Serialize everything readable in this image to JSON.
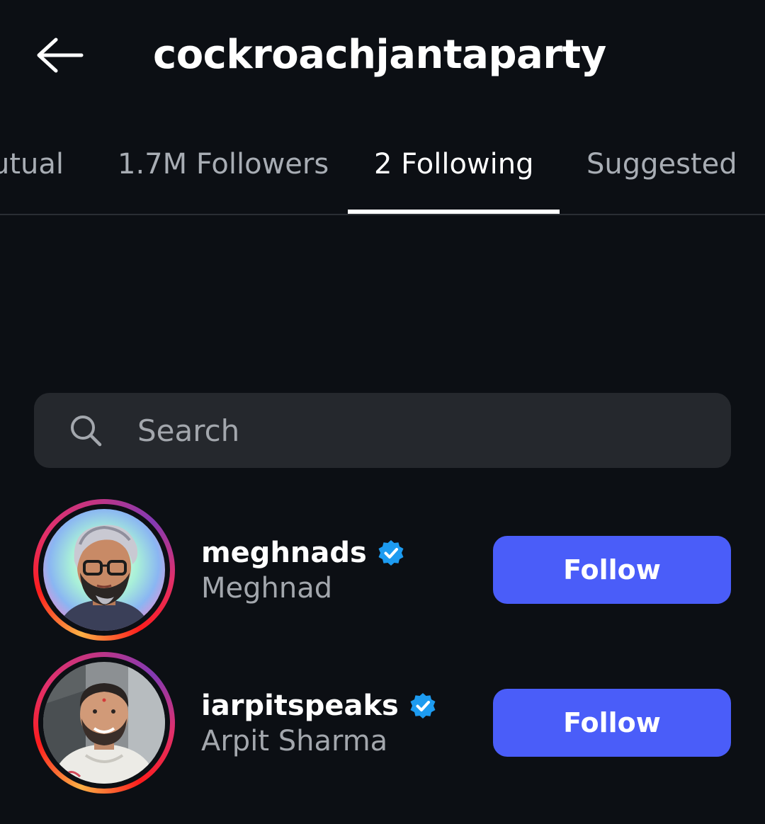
{
  "header": {
    "title": "cockroachjantaparty",
    "back_icon": "arrow-left-icon"
  },
  "tabs": [
    {
      "label": "Mutual",
      "visible_text": "utual",
      "active": false
    },
    {
      "label": "1.7M Followers",
      "active": false
    },
    {
      "label": "2 Following",
      "active": true
    },
    {
      "label": "Suggested",
      "active": false
    }
  ],
  "search": {
    "placeholder": "Search",
    "icon": "search-icon"
  },
  "following": [
    {
      "username": "meghnads",
      "full_name": "Meghnad",
      "verified": true,
      "button_label": "Follow",
      "has_story_ring": true
    },
    {
      "username": "iarpitspeaks",
      "full_name": "Arpit Sharma",
      "verified": true,
      "button_label": "Follow",
      "has_story_ring": true
    }
  ],
  "colors": {
    "background": "#0c0f14",
    "search_bg": "#25282d",
    "follow_button": "#4a5df9",
    "verified_badge": "#1d9bf0",
    "secondary_text": "#a3a7ad"
  }
}
